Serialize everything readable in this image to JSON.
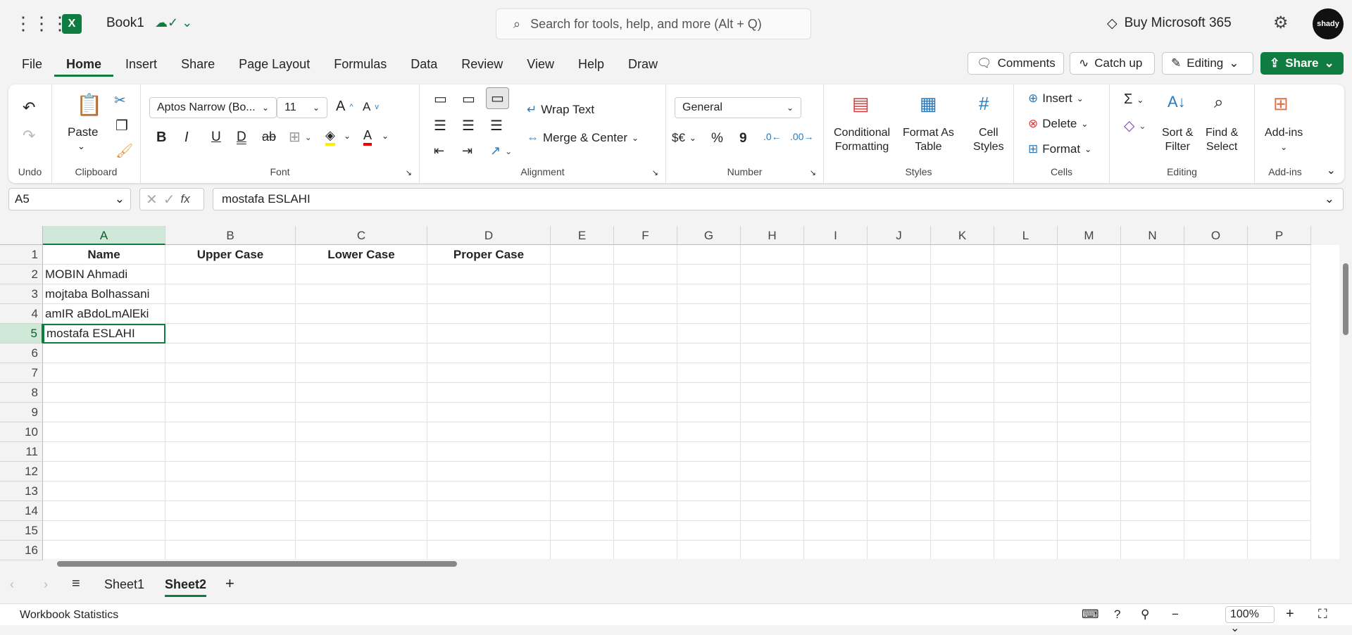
{
  "app": {
    "title": "Book1",
    "accent": "#107c41"
  },
  "search": {
    "placeholder": "Search for tools, help, and more (Alt + Q)"
  },
  "header": {
    "buy": "Buy Microsoft 365",
    "avatar": "shady"
  },
  "menu": {
    "tabs": [
      "File",
      "Home",
      "Insert",
      "Share",
      "Page Layout",
      "Formulas",
      "Data",
      "Review",
      "View",
      "Help",
      "Draw"
    ],
    "active": "Home"
  },
  "actions": {
    "comments": "Comments",
    "catchup": "Catch up",
    "editing": "Editing",
    "share": "Share"
  },
  "ribbon": {
    "undo": {
      "label": "Undo"
    },
    "clipboard": {
      "label": "Clipboard",
      "paste": "Paste"
    },
    "font": {
      "label": "Font",
      "name": "Aptos Narrow (Bo...",
      "size": "11",
      "bold": "B",
      "italic": "I",
      "underline": "U",
      "double": "D",
      "strike": "ab",
      "color_a": "A"
    },
    "alignment": {
      "label": "Alignment",
      "wrap": "Wrap Text",
      "merge": "Merge & Center"
    },
    "number": {
      "label": "Number",
      "format": "General",
      "currency": "$€",
      "percent": "%",
      "comma": "9"
    },
    "styles": {
      "label": "Styles",
      "cond1": "Conditional",
      "cond2": "Formatting",
      "fmt1": "Format As",
      "fmt2": "Table",
      "cell1": "Cell",
      "cell2": "Styles"
    },
    "cells": {
      "label": "Cells",
      "insert": "Insert",
      "delete": "Delete",
      "format": "Format"
    },
    "editing": {
      "label": "Editing",
      "sort1": "Sort &",
      "sort2": "Filter",
      "find1": "Find &",
      "find2": "Select"
    },
    "addins": {
      "label": "Add-ins",
      "btn": "Add-ins"
    }
  },
  "formula_bar": {
    "name_box": "A5",
    "fx": "fx",
    "value": "mostafa ESLAHI"
  },
  "columns": [
    "A",
    "B",
    "C",
    "D",
    "E",
    "F",
    "G",
    "H",
    "I",
    "J",
    "K",
    "L",
    "M",
    "N",
    "O",
    "P"
  ],
  "rows": [
    "1",
    "2",
    "3",
    "4",
    "5",
    "6",
    "7",
    "8",
    "9",
    "10",
    "11",
    "12",
    "13",
    "14",
    "15",
    "16"
  ],
  "cells": {
    "A1": "Name",
    "B1": "Upper Case",
    "C1": "Lower Case",
    "D1": "Proper Case",
    "A2": "MOBIN Ahmadi",
    "A3": "mojtaba Bolhassani",
    "A4": "amIR aBdoLmAlEki",
    "A5": "mostafa ESLAHI"
  },
  "selected_cell": "A5",
  "sheets": {
    "tabs": [
      "Sheet1",
      "Sheet2"
    ],
    "active": "Sheet2"
  },
  "status": {
    "left": "Workbook Statistics",
    "zoom": "100%"
  }
}
